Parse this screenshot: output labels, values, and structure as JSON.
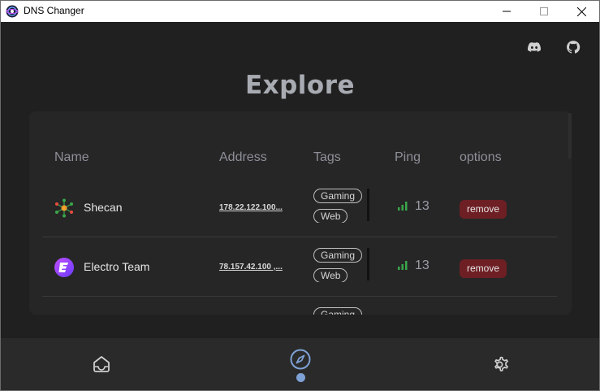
{
  "window": {
    "title": "DNS Changer"
  },
  "header": {
    "icons": [
      "discord-icon",
      "github-icon"
    ]
  },
  "page": {
    "title": "Explore"
  },
  "table": {
    "columns": [
      "Name",
      "Address",
      "Tags",
      "Ping",
      "options"
    ],
    "rows": [
      {
        "icon": "shecan-logo-icon",
        "name": "Shecan",
        "address": "178.22.122.100...",
        "tags": [
          "Gaming",
          "Web"
        ],
        "ping": "13",
        "action": "remove"
      },
      {
        "icon": "electro-logo-icon",
        "name": "Electro Team",
        "address": "78.157.42.100 ,...",
        "tags": [
          "Gaming",
          "Web"
        ],
        "ping": "13",
        "action": "remove"
      },
      {
        "tags": [
          "Gaming"
        ]
      }
    ]
  },
  "nav": {
    "items": [
      "home-icon",
      "compass-icon",
      "gear-icon"
    ],
    "active": "compass-icon"
  },
  "colors": {
    "background": "#202020",
    "card": "#262626",
    "remove_button": "#6e1f24",
    "signal": "#3aa64a",
    "active_nav": "#7fa2d6"
  }
}
